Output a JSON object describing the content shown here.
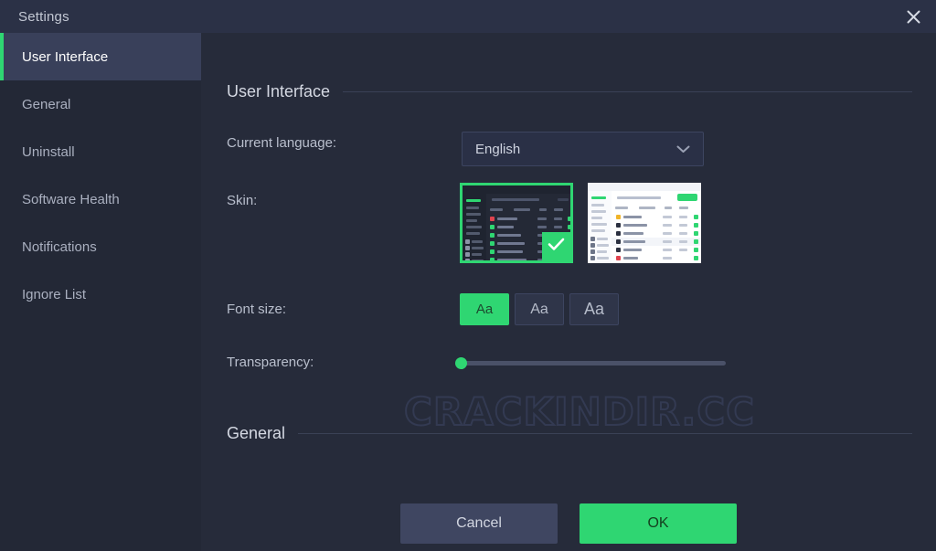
{
  "window": {
    "title": "Settings",
    "close_icon": "close-icon"
  },
  "sidebar": {
    "items": [
      {
        "label": "User Interface",
        "active": true
      },
      {
        "label": "General",
        "active": false
      },
      {
        "label": "Uninstall",
        "active": false
      },
      {
        "label": "Software Health",
        "active": false
      },
      {
        "label": "Notifications",
        "active": false
      },
      {
        "label": "Ignore List",
        "active": false
      }
    ]
  },
  "content": {
    "sections": [
      {
        "title": "User Interface"
      },
      {
        "title": "General"
      }
    ],
    "language": {
      "label": "Current language:",
      "value": "English",
      "chevron_icon": "chevron-down-icon"
    },
    "skin": {
      "label": "Skin:",
      "options": [
        {
          "name": "dark",
          "selected": true,
          "check_icon": "check-icon"
        },
        {
          "name": "light",
          "selected": false
        }
      ]
    },
    "font_size": {
      "label": "Font size:",
      "options": [
        {
          "label": "Aa",
          "selected": true
        },
        {
          "label": "Aa",
          "selected": false
        },
        {
          "label": "Aa",
          "selected": false
        }
      ]
    },
    "transparency": {
      "label": "Transparency:",
      "value": 0,
      "min": 0,
      "max": 100
    }
  },
  "watermark": {
    "text": "CRACKINDIR.CC"
  },
  "footer": {
    "cancel_label": "Cancel",
    "ok_label": "OK"
  },
  "colors": {
    "accent_green": "#2fd672",
    "window_bg": "#262b3a",
    "sidebar_bg": "#232836",
    "titlebar_bg": "#2b3146",
    "active_nav_bg": "#39405a"
  }
}
